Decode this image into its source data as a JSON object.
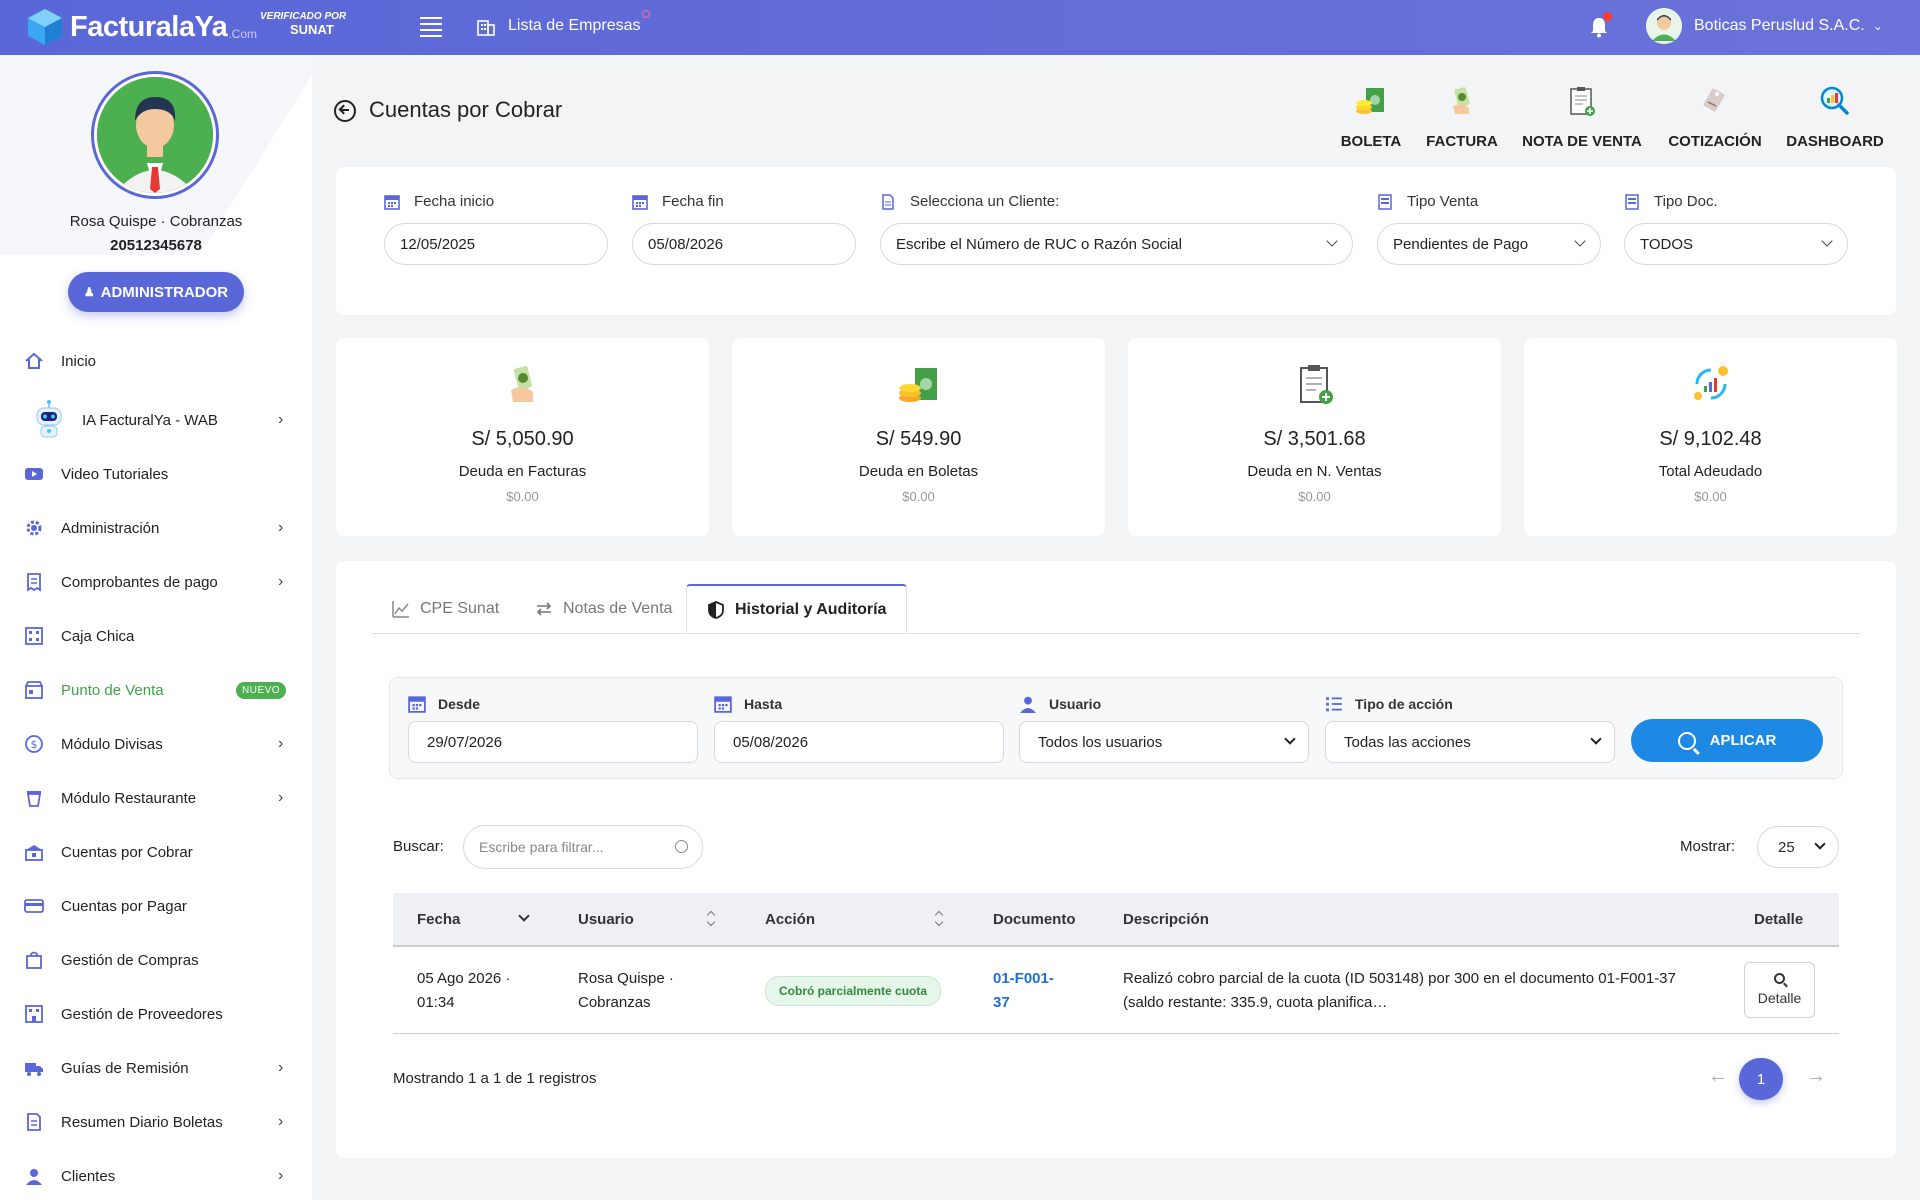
{
  "topbar": {
    "brand": "FacturalaYa",
    "brand_suffix": ".Com",
    "verified_line1": "VERIFICADO POR",
    "verified_line2": "SUNAT",
    "companies_link": "Lista de Empresas",
    "company_name": "Boticas Peruslud S.A.C."
  },
  "profile": {
    "name": "Rosa Quispe · Cobranzas",
    "ruc": "20512345678",
    "role_button": "ADMINISTRADOR"
  },
  "sidebar": {
    "items": [
      {
        "label": "Inicio",
        "icon": "home-icon",
        "chevron": false
      },
      {
        "label": "IA FacturalYa - WAB",
        "icon": "robot-icon",
        "chevron": true
      },
      {
        "label": "Video Tutoriales",
        "icon": "video-icon",
        "chevron": false
      },
      {
        "label": "Administración",
        "icon": "gear-icon",
        "chevron": true
      },
      {
        "label": "Comprobantes de pago",
        "icon": "receipt-icon",
        "chevron": true
      },
      {
        "label": "Caja Chica",
        "icon": "cash-box-icon",
        "chevron": false
      },
      {
        "label": "Punto de Venta",
        "icon": "store-icon",
        "chevron": false,
        "badge": "NUEVO"
      },
      {
        "label": "Módulo Divisas",
        "icon": "currency-icon",
        "chevron": true
      },
      {
        "label": "Módulo Restaurante",
        "icon": "restaurant-icon",
        "chevron": true
      },
      {
        "label": "Cuentas por Cobrar",
        "icon": "receivable-icon",
        "chevron": false
      },
      {
        "label": "Cuentas por Pagar",
        "icon": "card-icon",
        "chevron": false
      },
      {
        "label": "Gestión de Compras",
        "icon": "shopping-bag-icon",
        "chevron": false
      },
      {
        "label": "Gestión de Proveedores",
        "icon": "supplier-icon",
        "chevron": false
      },
      {
        "label": "Guías de Remisión",
        "icon": "truck-icon",
        "chevron": true
      },
      {
        "label": "Resumen Diario Boletas",
        "icon": "report-icon",
        "chevron": true
      },
      {
        "label": "Clientes",
        "icon": "clients-icon",
        "chevron": true
      }
    ]
  },
  "page": {
    "title": "Cuentas por Cobrar",
    "shortcuts": [
      {
        "label": "BOLETA",
        "icon": "boleta-icon"
      },
      {
        "label": "FACTURA",
        "icon": "factura-icon"
      },
      {
        "label": "NOTA DE VENTA",
        "icon": "nota-venta-icon"
      },
      {
        "label": "COTIZACIÓN",
        "icon": "cotizacion-icon"
      },
      {
        "label": "DASHBOARD",
        "icon": "dashboard-icon"
      }
    ]
  },
  "filters": {
    "fecha_inicio_label": "Fecha inicio",
    "fecha_inicio_value": "12/05/2025",
    "fecha_fin_label": "Fecha fin",
    "fecha_fin_value": "05/08/2026",
    "cliente_label": "Selecciona un Cliente:",
    "cliente_placeholder": "Escribe el Número de RUC o Razón Social",
    "tipo_venta_label": "Tipo Venta",
    "tipo_venta_value": "Pendientes de Pago",
    "tipo_doc_label": "Tipo Doc.",
    "tipo_doc_value": "TODOS"
  },
  "stats": [
    {
      "value": "S/ 5,050.90",
      "label": "Deuda en Facturas",
      "sub": "$0.00",
      "icon": "money-hand-icon"
    },
    {
      "value": "S/ 549.90",
      "label": "Deuda en Boletas",
      "sub": "$0.00",
      "icon": "coins-icon"
    },
    {
      "value": "S/ 3,501.68",
      "label": "Deuda en N. Ventas",
      "sub": "$0.00",
      "icon": "clipboard-plus-icon"
    },
    {
      "value": "S/ 9,102.48",
      "label": "Total Adeudado",
      "sub": "$0.00",
      "icon": "growth-icon"
    }
  ],
  "tabs": [
    {
      "label": "CPE Sunat",
      "icon": "chart-icon"
    },
    {
      "label": "Notas de Venta",
      "icon": "swap-icon"
    },
    {
      "label": "Historial y Auditoría",
      "icon": "shield-icon",
      "active": true
    }
  ],
  "audit_filter": {
    "desde_label": "Desde",
    "desde_value": "29/07/2026",
    "hasta_label": "Hasta",
    "hasta_value": "05/08/2026",
    "usuario_label": "Usuario",
    "usuario_value": "Todos los usuarios",
    "accion_label": "Tipo de acción",
    "accion_value": "Todas las acciones",
    "apply_label": "APLICAR"
  },
  "table_controls": {
    "search_label": "Buscar:",
    "search_placeholder": "Escribe para filtrar...",
    "show_label": "Mostrar:",
    "show_value": "25"
  },
  "table": {
    "headers": [
      "Fecha",
      "Usuario",
      "Acción",
      "Documento",
      "Descripción",
      "Detalle"
    ],
    "rows": [
      {
        "fecha_line1": "05 Ago 2026 ·",
        "fecha_line2": "01:34",
        "usuario_line1": "Rosa Quispe ·",
        "usuario_line2": "Cobranzas",
        "accion": "Cobró parcialmente cuota",
        "documento_line1": "01-F001-",
        "documento_line2": "37",
        "descripcion_line1": "Realizó cobro parcial de la cuota (ID 503148) por 300 en el documento 01-F001-37",
        "descripcion_line2": "(saldo restante: 335.9, cuota planifica…",
        "detalle": "Detalle"
      }
    ]
  },
  "pagination": {
    "summary": "Mostrando 1 a 1 de 1 registros",
    "prev": "←",
    "current": "1",
    "next": "→"
  },
  "colors": {
    "primary": "#5a67d8",
    "apply": "#1e88e5",
    "success": "#4caf50",
    "link": "#1e6fd9"
  }
}
